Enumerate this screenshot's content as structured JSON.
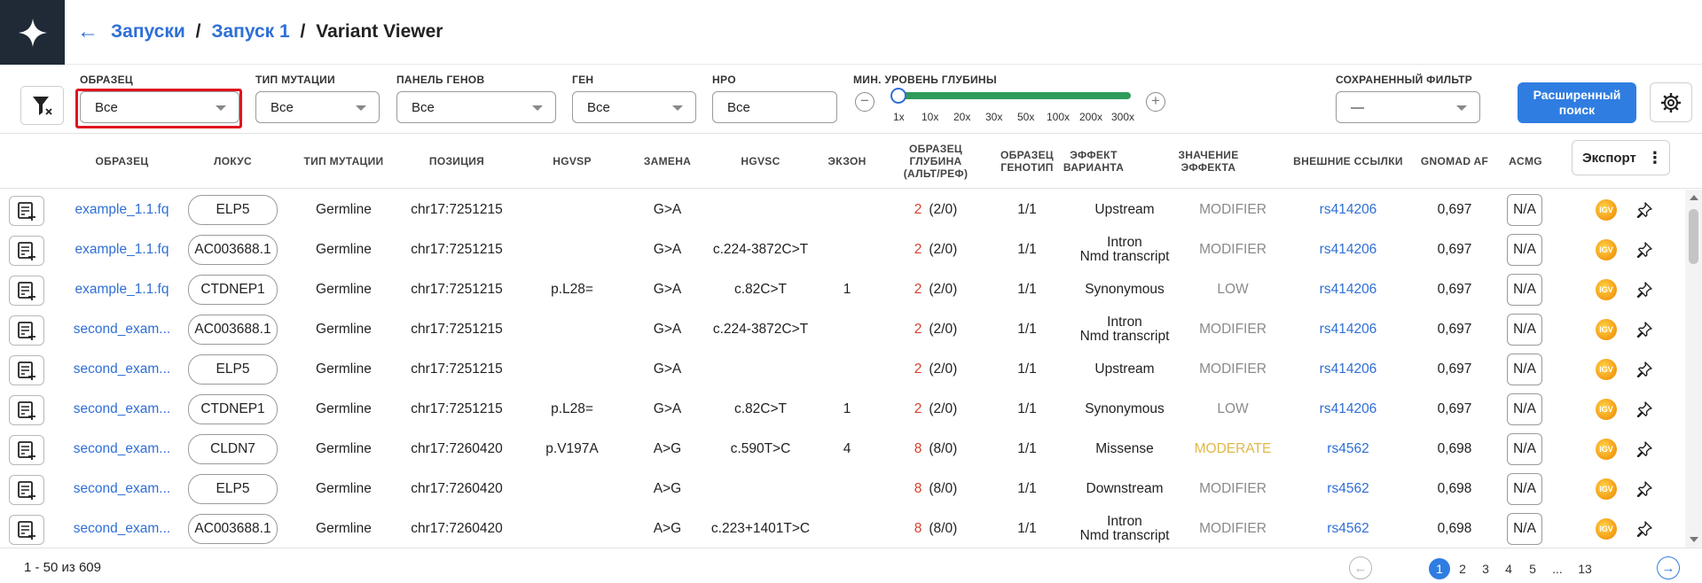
{
  "header": {
    "back_arrow": "←",
    "crumbs": [
      "Запуски",
      "Запуск 1"
    ],
    "separator": "/",
    "current": "Variant Viewer"
  },
  "filters": {
    "sample": {
      "label": "ОБРАЗЕЦ",
      "value": "Все"
    },
    "mutation_type": {
      "label": "ТИП МУТАЦИИ",
      "value": "Все"
    },
    "gene_panel": {
      "label": "ПАНЕЛЬ ГЕНОВ",
      "value": "Все"
    },
    "gene": {
      "label": "ГЕН",
      "value": "Все"
    },
    "hpo": {
      "label": "HPO",
      "value": "Все"
    },
    "depth": {
      "label": "МИН. УРОВЕНЬ ГЛУБИНЫ",
      "ticks": [
        "1x",
        "10x",
        "20x",
        "30x",
        "50x",
        "100x",
        "200x",
        "300x"
      ],
      "selected": "1x",
      "minus": "−",
      "plus": "+"
    },
    "saved": {
      "label": "СОХРАНЕННЫЙ ФИЛЬТР",
      "value": "—"
    },
    "advanced_button": "Расширенный поиск"
  },
  "table": {
    "columns": {
      "sample": "ОБРАЗЕЦ",
      "locus": "ЛОКУС",
      "mut_type": "ТИП МУТАЦИИ",
      "position": "ПОЗИЦИЯ",
      "hgvsp": "HGVSP",
      "change": "ЗАМЕНА",
      "hgvsc": "HGVSC",
      "exon": "ЭКЗОН",
      "depth": "ОБРАЗЕЦ ГЛУБИНА (АЛЬТ/РЕФ)",
      "genotype": "ОБРАЗЕЦ ГЕНОТИП",
      "effect": "ЭФФЕКТ ВАРИАНТА",
      "impact": "ЗНАЧЕНИЕ ЭФФЕКТА",
      "links": "ВНЕШНИЕ ССЫЛКИ",
      "gnomad": "GNOMAD AF",
      "acmg": "ACMG"
    },
    "export_label": "Экспорт",
    "export_dots": "⋮",
    "igv_label": "IGV",
    "rows": [
      {
        "sample": "example_1.1.fq",
        "locus": "ELP5",
        "mut_type": "Germline",
        "position": "chr17:7251215",
        "hgvsp": "",
        "change": "G>A",
        "hgvsc": "",
        "exon": "",
        "depth": "2",
        "depth_ar": "(2/0)",
        "genotype": "1/1",
        "effect1": "Upstream",
        "effect2": "",
        "impact": "MODIFIER",
        "link": "rs414206",
        "gnomad": "0,697",
        "acmg": "N/A"
      },
      {
        "sample": "example_1.1.fq",
        "locus": "AC003688.1",
        "mut_type": "Germline",
        "position": "chr17:7251215",
        "hgvsp": "",
        "change": "G>A",
        "hgvsc": "c.224-3872C>T",
        "exon": "",
        "depth": "2",
        "depth_ar": "(2/0)",
        "genotype": "1/1",
        "effect1": "Intron",
        "effect2": "Nmd transcript",
        "impact": "MODIFIER",
        "link": "rs414206",
        "gnomad": "0,697",
        "acmg": "N/A"
      },
      {
        "sample": "example_1.1.fq",
        "locus": "CTDNEP1",
        "mut_type": "Germline",
        "position": "chr17:7251215",
        "hgvsp": "p.L28=",
        "change": "G>A",
        "hgvsc": "c.82C>T",
        "exon": "1",
        "depth": "2",
        "depth_ar": "(2/0)",
        "genotype": "1/1",
        "effect1": "Synonymous",
        "effect2": "",
        "impact": "LOW",
        "link": "rs414206",
        "gnomad": "0,697",
        "acmg": "N/A"
      },
      {
        "sample": "second_exam...",
        "locus": "AC003688.1",
        "mut_type": "Germline",
        "position": "chr17:7251215",
        "hgvsp": "",
        "change": "G>A",
        "hgvsc": "c.224-3872C>T",
        "exon": "",
        "depth": "2",
        "depth_ar": "(2/0)",
        "genotype": "1/1",
        "effect1": "Intron",
        "effect2": "Nmd transcript",
        "impact": "MODIFIER",
        "link": "rs414206",
        "gnomad": "0,697",
        "acmg": "N/A"
      },
      {
        "sample": "second_exam...",
        "locus": "ELP5",
        "mut_type": "Germline",
        "position": "chr17:7251215",
        "hgvsp": "",
        "change": "G>A",
        "hgvsc": "",
        "exon": "",
        "depth": "2",
        "depth_ar": "(2/0)",
        "genotype": "1/1",
        "effect1": "Upstream",
        "effect2": "",
        "impact": "MODIFIER",
        "link": "rs414206",
        "gnomad": "0,697",
        "acmg": "N/A"
      },
      {
        "sample": "second_exam...",
        "locus": "CTDNEP1",
        "mut_type": "Germline",
        "position": "chr17:7251215",
        "hgvsp": "p.L28=",
        "change": "G>A",
        "hgvsc": "c.82C>T",
        "exon": "1",
        "depth": "2",
        "depth_ar": "(2/0)",
        "genotype": "1/1",
        "effect1": "Synonymous",
        "effect2": "",
        "impact": "LOW",
        "link": "rs414206",
        "gnomad": "0,697",
        "acmg": "N/A"
      },
      {
        "sample": "second_exam...",
        "locus": "CLDN7",
        "mut_type": "Germline",
        "position": "chr17:7260420",
        "hgvsp": "p.V197A",
        "change": "A>G",
        "hgvsc": "c.590T>C",
        "exon": "4",
        "depth": "8",
        "depth_ar": "(8/0)",
        "genotype": "1/1",
        "effect1": "Missense",
        "effect2": "",
        "impact": "MODERATE",
        "link": "rs4562",
        "gnomad": "0,698",
        "acmg": "N/A"
      },
      {
        "sample": "second_exam...",
        "locus": "ELP5",
        "mut_type": "Germline",
        "position": "chr17:7260420",
        "hgvsp": "",
        "change": "A>G",
        "hgvsc": "",
        "exon": "",
        "depth": "8",
        "depth_ar": "(8/0)",
        "genotype": "1/1",
        "effect1": "Downstream",
        "effect2": "",
        "impact": "MODIFIER",
        "link": "rs4562",
        "gnomad": "0,698",
        "acmg": "N/A"
      },
      {
        "sample": "second_exam...",
        "locus": "AC003688.1",
        "mut_type": "Germline",
        "position": "chr17:7260420",
        "hgvsp": "",
        "change": "A>G",
        "hgvsc": "c.223+1401T>C",
        "exon": "",
        "depth": "8",
        "depth_ar": "(8/0)",
        "genotype": "1/1",
        "effect1": "Intron",
        "effect2": "Nmd transcript",
        "impact": "MODIFIER",
        "link": "rs4562",
        "gnomad": "0,698",
        "acmg": "N/A"
      }
    ]
  },
  "footer": {
    "range": "1 - 50 из 609",
    "pages": [
      "1",
      "2",
      "3",
      "4",
      "5",
      "...",
      "13"
    ],
    "active_page": "1",
    "prev": "←",
    "next": "→"
  },
  "colors": {
    "accent": "#2f7de1",
    "logo_bg": "#1f2a36",
    "slider": "#2f9b5a",
    "depth": "#d8402a",
    "moderate": "#e0b846",
    "highlight": "#e0141e"
  }
}
